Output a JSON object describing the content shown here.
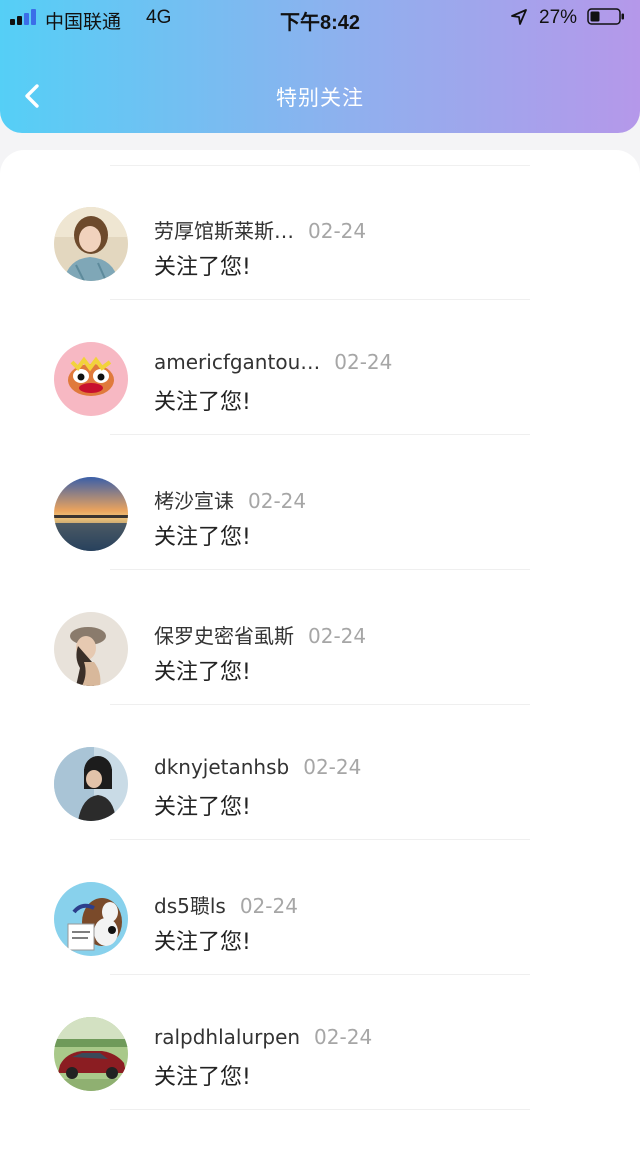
{
  "status_bar": {
    "carrier": "中国联通",
    "network": "4G",
    "time": "下午8:42",
    "battery": "27%"
  },
  "nav": {
    "title": "特别关注"
  },
  "list": [
    {
      "name": "劳厚馆斯莱斯…",
      "date": "02-24",
      "message": "关注了您!"
    },
    {
      "name": "americfgantou…",
      "date": "02-24",
      "message": "关注了您!"
    },
    {
      "name": "栲沙宣诔",
      "date": "02-24",
      "message": "关注了您!"
    },
    {
      "name": "保罗史密省虱斯",
      "date": "02-24",
      "message": "关注了您!"
    },
    {
      "name": "dknyjetanhsb",
      "date": "02-24",
      "message": "关注了您!"
    },
    {
      "name": "ds5聩ls",
      "date": "02-24",
      "message": "关注了您!"
    },
    {
      "name": "ralpdhlalurpen",
      "date": "02-24",
      "message": "关注了您!"
    }
  ]
}
